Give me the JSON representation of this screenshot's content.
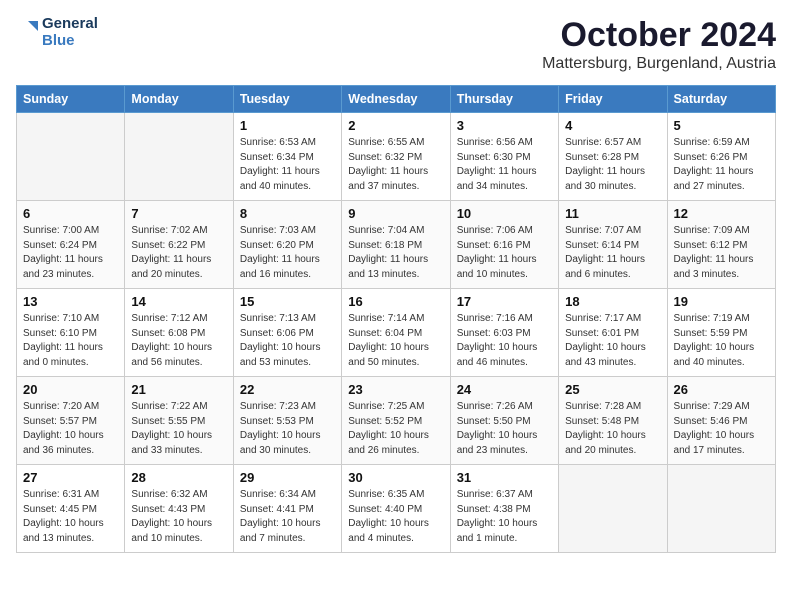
{
  "header": {
    "logo_line1": "General",
    "logo_line2": "Blue",
    "month_title": "October 2024",
    "subtitle": "Mattersburg, Burgenland, Austria"
  },
  "weekdays": [
    "Sunday",
    "Monday",
    "Tuesday",
    "Wednesday",
    "Thursday",
    "Friday",
    "Saturday"
  ],
  "weeks": [
    [
      {
        "day": "",
        "empty": true
      },
      {
        "day": "",
        "empty": true
      },
      {
        "day": "1",
        "sunrise": "6:53 AM",
        "sunset": "6:34 PM",
        "daylight": "11 hours and 40 minutes."
      },
      {
        "day": "2",
        "sunrise": "6:55 AM",
        "sunset": "6:32 PM",
        "daylight": "11 hours and 37 minutes."
      },
      {
        "day": "3",
        "sunrise": "6:56 AM",
        "sunset": "6:30 PM",
        "daylight": "11 hours and 34 minutes."
      },
      {
        "day": "4",
        "sunrise": "6:57 AM",
        "sunset": "6:28 PM",
        "daylight": "11 hours and 30 minutes."
      },
      {
        "day": "5",
        "sunrise": "6:59 AM",
        "sunset": "6:26 PM",
        "daylight": "11 hours and 27 minutes."
      }
    ],
    [
      {
        "day": "6",
        "sunrise": "7:00 AM",
        "sunset": "6:24 PM",
        "daylight": "11 hours and 23 minutes."
      },
      {
        "day": "7",
        "sunrise": "7:02 AM",
        "sunset": "6:22 PM",
        "daylight": "11 hours and 20 minutes."
      },
      {
        "day": "8",
        "sunrise": "7:03 AM",
        "sunset": "6:20 PM",
        "daylight": "11 hours and 16 minutes."
      },
      {
        "day": "9",
        "sunrise": "7:04 AM",
        "sunset": "6:18 PM",
        "daylight": "11 hours and 13 minutes."
      },
      {
        "day": "10",
        "sunrise": "7:06 AM",
        "sunset": "6:16 PM",
        "daylight": "11 hours and 10 minutes."
      },
      {
        "day": "11",
        "sunrise": "7:07 AM",
        "sunset": "6:14 PM",
        "daylight": "11 hours and 6 minutes."
      },
      {
        "day": "12",
        "sunrise": "7:09 AM",
        "sunset": "6:12 PM",
        "daylight": "11 hours and 3 minutes."
      }
    ],
    [
      {
        "day": "13",
        "sunrise": "7:10 AM",
        "sunset": "6:10 PM",
        "daylight": "11 hours and 0 minutes."
      },
      {
        "day": "14",
        "sunrise": "7:12 AM",
        "sunset": "6:08 PM",
        "daylight": "10 hours and 56 minutes."
      },
      {
        "day": "15",
        "sunrise": "7:13 AM",
        "sunset": "6:06 PM",
        "daylight": "10 hours and 53 minutes."
      },
      {
        "day": "16",
        "sunrise": "7:14 AM",
        "sunset": "6:04 PM",
        "daylight": "10 hours and 50 minutes."
      },
      {
        "day": "17",
        "sunrise": "7:16 AM",
        "sunset": "6:03 PM",
        "daylight": "10 hours and 46 minutes."
      },
      {
        "day": "18",
        "sunrise": "7:17 AM",
        "sunset": "6:01 PM",
        "daylight": "10 hours and 43 minutes."
      },
      {
        "day": "19",
        "sunrise": "7:19 AM",
        "sunset": "5:59 PM",
        "daylight": "10 hours and 40 minutes."
      }
    ],
    [
      {
        "day": "20",
        "sunrise": "7:20 AM",
        "sunset": "5:57 PM",
        "daylight": "10 hours and 36 minutes."
      },
      {
        "day": "21",
        "sunrise": "7:22 AM",
        "sunset": "5:55 PM",
        "daylight": "10 hours and 33 minutes."
      },
      {
        "day": "22",
        "sunrise": "7:23 AM",
        "sunset": "5:53 PM",
        "daylight": "10 hours and 30 minutes."
      },
      {
        "day": "23",
        "sunrise": "7:25 AM",
        "sunset": "5:52 PM",
        "daylight": "10 hours and 26 minutes."
      },
      {
        "day": "24",
        "sunrise": "7:26 AM",
        "sunset": "5:50 PM",
        "daylight": "10 hours and 23 minutes."
      },
      {
        "day": "25",
        "sunrise": "7:28 AM",
        "sunset": "5:48 PM",
        "daylight": "10 hours and 20 minutes."
      },
      {
        "day": "26",
        "sunrise": "7:29 AM",
        "sunset": "5:46 PM",
        "daylight": "10 hours and 17 minutes."
      }
    ],
    [
      {
        "day": "27",
        "sunrise": "6:31 AM",
        "sunset": "4:45 PM",
        "daylight": "10 hours and 13 minutes."
      },
      {
        "day": "28",
        "sunrise": "6:32 AM",
        "sunset": "4:43 PM",
        "daylight": "10 hours and 10 minutes."
      },
      {
        "day": "29",
        "sunrise": "6:34 AM",
        "sunset": "4:41 PM",
        "daylight": "10 hours and 7 minutes."
      },
      {
        "day": "30",
        "sunrise": "6:35 AM",
        "sunset": "4:40 PM",
        "daylight": "10 hours and 4 minutes."
      },
      {
        "day": "31",
        "sunrise": "6:37 AM",
        "sunset": "4:38 PM",
        "daylight": "10 hours and 1 minute."
      },
      {
        "day": "",
        "empty": true
      },
      {
        "day": "",
        "empty": true
      }
    ]
  ]
}
